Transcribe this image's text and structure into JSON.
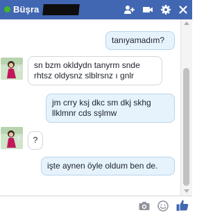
{
  "header": {
    "contact_name": "Büşra",
    "icons": [
      "online-status-dot",
      "add-person-icon",
      "video-call-icon",
      "gear-icon",
      "close-icon"
    ]
  },
  "messages": [
    {
      "direction": "outgoing",
      "text": "tanıyamadım?"
    },
    {
      "direction": "incoming",
      "text_line1": "sn bzm okldydn tanyrm snde",
      "text_line2": "rhtsz oldysnz slblrsnz ı gnlr"
    },
    {
      "direction": "outgoing",
      "text_line1": "jm crry ksj dkc sm dkj skhg",
      "text_line2": "llklmnr cds sşlmw"
    },
    {
      "direction": "incoming",
      "text": "?"
    },
    {
      "direction": "outgoing",
      "text": "işte aynen öyle oldum ben de."
    }
  ],
  "composer": {
    "icons": [
      "camera-icon",
      "emoji-icon",
      "like-icon"
    ]
  },
  "colors": {
    "header_bg": "#4267b2",
    "online": "#42b72a",
    "outgoing_bubble": "#e6f3fd",
    "like_blue": "#4267b2"
  }
}
